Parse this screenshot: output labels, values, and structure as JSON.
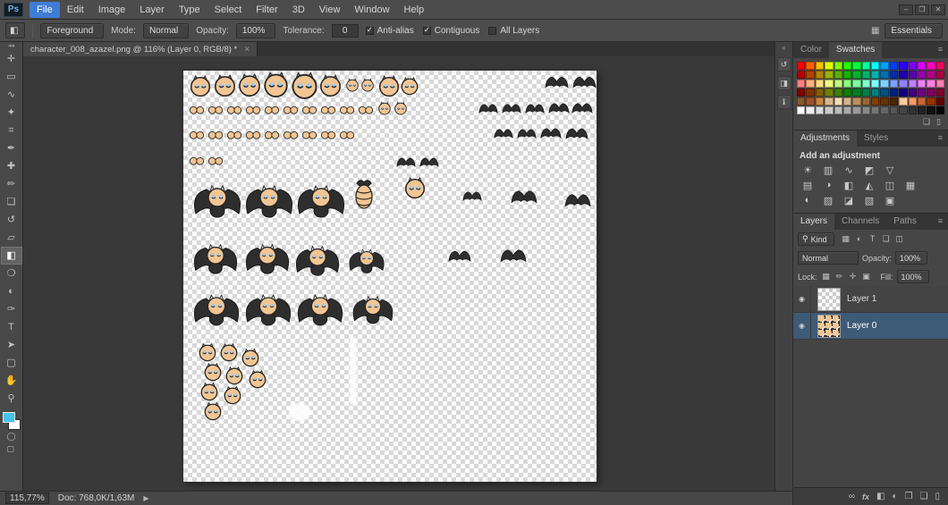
{
  "ui": {
    "caret": "▾",
    "panel_menu": "≡",
    "eye": "◉",
    "search": "⚲"
  },
  "app": {
    "logo": "Ps"
  },
  "window_controls": [
    {
      "name": "minimize",
      "glyph": "–"
    },
    {
      "name": "restore",
      "glyph": "❐"
    },
    {
      "name": "close",
      "glyph": "✕"
    }
  ],
  "menu": {
    "items": [
      {
        "label": "File",
        "active": true
      },
      {
        "label": "Edit"
      },
      {
        "label": "Image"
      },
      {
        "label": "Layer"
      },
      {
        "label": "Type"
      },
      {
        "label": "Select"
      },
      {
        "label": "Filter"
      },
      {
        "label": "3D"
      },
      {
        "label": "View"
      },
      {
        "label": "Window"
      },
      {
        "label": "Help"
      }
    ]
  },
  "options": {
    "tool_preset_glyph": "◧",
    "fill_source": {
      "value": "Foreground"
    },
    "mode_label": "Mode:",
    "mode_value": "Normal",
    "opacity_label": "Opacity:",
    "opacity_value": "100%",
    "tolerance_label": "Tolerance:",
    "tolerance_value": "0",
    "checkboxes": [
      {
        "label": "Anti-alias",
        "checked": true
      },
      {
        "label": "Contiguous",
        "checked": true
      },
      {
        "label": "All Layers",
        "checked": false
      }
    ],
    "workspace": {
      "label": "Essentials",
      "grid_glyph": "▦"
    }
  },
  "document_tab": {
    "title": "character_008_azazel.png @ 116% (Layer 0, RGB/8) *",
    "close_glyph": "×"
  },
  "toolbar": {
    "collapse_glyph": "◂◂",
    "tools": [
      {
        "name": "move",
        "glyph": "✛"
      },
      {
        "name": "rectangular-marquee",
        "glyph": "▭"
      },
      {
        "name": "lasso",
        "glyph": "∿"
      },
      {
        "name": "magic-wand",
        "glyph": "✦"
      },
      {
        "name": "crop",
        "glyph": "⌗"
      },
      {
        "name": "eyedropper",
        "glyph": "✒"
      },
      {
        "name": "spot-healing-brush",
        "glyph": "✚"
      },
      {
        "name": "brush",
        "glyph": "✏"
      },
      {
        "name": "clone-stamp",
        "glyph": "❏"
      },
      {
        "name": "history-brush",
        "glyph": "↺"
      },
      {
        "name": "eraser",
        "glyph": "▱"
      },
      {
        "name": "paint-bucket",
        "glyph": "◧",
        "selected": true
      },
      {
        "name": "blur",
        "glyph": "❍"
      },
      {
        "name": "dodge",
        "glyph": "◐"
      },
      {
        "name": "pen",
        "glyph": "✑"
      },
      {
        "name": "type",
        "glyph": "T"
      },
      {
        "name": "path-selection",
        "glyph": "➤"
      },
      {
        "name": "rectangle",
        "glyph": "▢"
      },
      {
        "name": "hand",
        "glyph": "✋"
      },
      {
        "name": "zoom",
        "glyph": "⚲"
      }
    ],
    "foreground_color": "#44c4e6",
    "background_color": "#ffffff",
    "extras": [
      {
        "name": "quick-mask",
        "glyph": "◯"
      },
      {
        "name": "screen-mode",
        "glyph": "▢"
      }
    ]
  },
  "dock": {
    "collapse_glyph": "«",
    "icons": [
      {
        "name": "history",
        "glyph": "↺"
      },
      {
        "name": "properties",
        "glyph": "◨"
      },
      {
        "name": "info",
        "glyph": "ℹ"
      }
    ]
  },
  "panels": {
    "colors": {
      "tabs": [
        {
          "label": "Color"
        },
        {
          "label": "Swatches",
          "active": true
        }
      ],
      "palette": [
        "#ff0000",
        "#ff6000",
        "#ffbf00",
        "#dfff00",
        "#80ff00",
        "#21ff00",
        "#00ff40",
        "#00ffa0",
        "#00ffff",
        "#00a0ff",
        "#0040ff",
        "#2a00ff",
        "#8000ff",
        "#df00ff",
        "#ff00bf",
        "#ff0060",
        "#b30000",
        "#b34300",
        "#b38600",
        "#9cb300",
        "#59b300",
        "#17b300",
        "#00b32d",
        "#00b370",
        "#00b3b3",
        "#0070b3",
        "#002db3",
        "#1d00b3",
        "#5900b3",
        "#9c00b3",
        "#b30086",
        "#b30043",
        "#ff8080",
        "#ffb080",
        "#ffdf80",
        "#efff80",
        "#bfff80",
        "#90ff80",
        "#80ffa0",
        "#80ffd0",
        "#80ffff",
        "#80d0ff",
        "#80a0ff",
        "#9580ff",
        "#c080ff",
        "#ef80ff",
        "#ff80df",
        "#ff80b0",
        "#800000",
        "#803000",
        "#806000",
        "#708000",
        "#408000",
        "#108000",
        "#008020",
        "#008050",
        "#008080",
        "#005080",
        "#002080",
        "#150080",
        "#400080",
        "#700080",
        "#800060",
        "#800030",
        "#8b5a2b",
        "#a0522d",
        "#cd853f",
        "#deb887",
        "#f5deb3",
        "#d2b48c",
        "#bc8f60",
        "#996633",
        "#804000",
        "#663300",
        "#4d2600",
        "#ffcc99",
        "#ff9966",
        "#cc6633",
        "#993300",
        "#660000",
        "#ffffff",
        "#eeeeee",
        "#dddddd",
        "#cccccc",
        "#bbbbbb",
        "#aaaaaa",
        "#999999",
        "#888888",
        "#777777",
        "#666666",
        "#555555",
        "#444444",
        "#333333",
        "#222222",
        "#111111",
        "#000000"
      ],
      "buttons": [
        {
          "name": "new-swatch",
          "glyph": "❏"
        },
        {
          "name": "delete-swatch",
          "glyph": "▯"
        }
      ]
    },
    "adjustments": {
      "tabs": [
        {
          "label": "Adjustments",
          "active": true
        },
        {
          "label": "Styles"
        }
      ],
      "heading": "Add an adjustment",
      "rows": [
        [
          {
            "name": "brightness-contrast",
            "glyph": "☀"
          },
          {
            "name": "levels",
            "glyph": "▥"
          },
          {
            "name": "curves",
            "glyph": "∿"
          },
          {
            "name": "exposure",
            "glyph": "◩"
          },
          {
            "name": "vibrance",
            "glyph": "▽"
          }
        ],
        [
          {
            "name": "hue-saturation",
            "glyph": "▤"
          },
          {
            "name": "color-balance",
            "glyph": "◑"
          },
          {
            "name": "black-white",
            "glyph": "◧"
          },
          {
            "name": "photo-filter",
            "glyph": "◭"
          },
          {
            "name": "channel-mixer",
            "glyph": "◫"
          },
          {
            "name": "color-lookup",
            "glyph": "▦"
          }
        ],
        [
          {
            "name": "invert",
            "glyph": "◐"
          },
          {
            "name": "posterize",
            "glyph": "▨"
          },
          {
            "name": "threshold",
            "glyph": "◪"
          },
          {
            "name": "gradient-map",
            "glyph": "▧"
          },
          {
            "name": "selective-color",
            "glyph": "▣"
          }
        ]
      ]
    },
    "layers": {
      "tabs": [
        {
          "label": "Layers",
          "active": true
        },
        {
          "label": "Channels"
        },
        {
          "label": "Paths"
        }
      ],
      "filter": {
        "kind_label": "Kind",
        "icons": [
          {
            "name": "filter-pixel-layers",
            "glyph": "▦"
          },
          {
            "name": "filter-adjustment-layers",
            "glyph": "◐"
          },
          {
            "name": "filter-type-layers",
            "glyph": "T"
          },
          {
            "name": "filter-shape-layers",
            "glyph": "❏"
          },
          {
            "name": "filter-smart-objects",
            "glyph": "◫"
          }
        ]
      },
      "blend": {
        "value": "Normal",
        "opacity_label": "Opacity:",
        "opacity_value": "100%"
      },
      "lock": {
        "label": "Lock:",
        "icons": [
          {
            "name": "lock-transparent-pixels",
            "glyph": "▦"
          },
          {
            "name": "lock-image-pixels",
            "glyph": "✏"
          },
          {
            "name": "lock-position",
            "glyph": "✛"
          },
          {
            "name": "lock-all",
            "glyph": "▣"
          }
        ],
        "fill_label": "Fill:",
        "fill_value": "100%"
      },
      "items": [
        {
          "name": "Layer 1",
          "selected": false,
          "thumb": "checker"
        },
        {
          "name": "Layer 0",
          "selected": true,
          "thumb": "sprite"
        }
      ],
      "footer": [
        {
          "name": "link-layers",
          "glyph": "∞"
        },
        {
          "name": "layer-effects",
          "glyph": "fx"
        },
        {
          "name": "add-layer-mask",
          "glyph": "◧"
        },
        {
          "name": "new-adjustment-layer",
          "glyph": "◐"
        },
        {
          "name": "new-group",
          "glyph": "❐"
        },
        {
          "name": "new-layer",
          "glyph": "❏"
        },
        {
          "name": "delete-layer",
          "glyph": "▯"
        }
      ]
    }
  },
  "canvas": {
    "sprite_colors": {
      "skin": "#f3c592",
      "wing": "#2e2e2e",
      "outline": "#262626",
      "horn": "#ececec",
      "eyelid": "#a9c9e2"
    },
    "sprites": [
      [
        "h",
        6,
        4,
        26
      ],
      [
        "h",
        33,
        3,
        27
      ],
      [
        "h",
        60,
        2,
        28
      ],
      [
        "h",
        88,
        0,
        31
      ],
      [
        "h",
        119,
        0,
        33
      ],
      [
        "h",
        151,
        3,
        27
      ],
      [
        "h",
        181,
        8,
        16
      ],
      [
        "h",
        198,
        8,
        16
      ],
      [
        "h",
        217,
        4,
        26
      ],
      [
        "h",
        242,
        6,
        22
      ],
      [
        "w",
        404,
        5,
        27
      ],
      [
        "w",
        435,
        5,
        27
      ],
      [
        "e",
        6,
        38,
        18
      ],
      [
        "e",
        27,
        38,
        18
      ],
      [
        "e",
        48,
        38,
        18
      ],
      [
        "e",
        69,
        38,
        18
      ],
      [
        "e",
        90,
        38,
        18
      ],
      [
        "e",
        111,
        38,
        18
      ],
      [
        "e",
        132,
        38,
        18
      ],
      [
        "e",
        153,
        38,
        18
      ],
      [
        "e",
        174,
        38,
        18
      ],
      [
        "e",
        195,
        38,
        18
      ],
      [
        "h",
        217,
        34,
        16
      ],
      [
        "h",
        235,
        34,
        16
      ],
      [
        "w",
        330,
        36,
        22
      ],
      [
        "w",
        356,
        36,
        22
      ],
      [
        "w",
        382,
        36,
        22
      ],
      [
        "w",
        408,
        35,
        24
      ],
      [
        "w",
        434,
        35,
        24
      ],
      [
        "e",
        6,
        66,
        18
      ],
      [
        "e",
        27,
        66,
        18
      ],
      [
        "e",
        48,
        66,
        18
      ],
      [
        "e",
        69,
        66,
        18
      ],
      [
        "e",
        90,
        66,
        18
      ],
      [
        "e",
        111,
        66,
        18
      ],
      [
        "e",
        132,
        66,
        18
      ],
      [
        "e",
        153,
        66,
        18
      ],
      [
        "e",
        174,
        66,
        18
      ],
      [
        "w",
        347,
        64,
        22
      ],
      [
        "w",
        373,
        64,
        22
      ],
      [
        "w",
        399,
        63,
        24
      ],
      [
        "w",
        427,
        63,
        26
      ],
      [
        "e",
        6,
        95,
        18
      ],
      [
        "e",
        27,
        95,
        18
      ],
      [
        "w",
        238,
        96,
        22
      ],
      [
        "w",
        264,
        96,
        22
      ],
      [
        "b",
        10,
        126,
        56
      ],
      [
        "b",
        68,
        126,
        56
      ],
      [
        "b",
        126,
        126,
        56
      ],
      [
        "p",
        190,
        120,
        24
      ],
      [
        "h",
        246,
        118,
        26
      ],
      [
        "w",
        312,
        134,
        22
      ],
      [
        "w",
        366,
        132,
        30
      ],
      [
        "w",
        426,
        136,
        30
      ],
      [
        "b",
        10,
        192,
        52
      ],
      [
        "b",
        68,
        192,
        52
      ],
      [
        "b",
        124,
        194,
        52
      ],
      [
        "b",
        184,
        198,
        42
      ],
      [
        "w",
        296,
        200,
        26
      ],
      [
        "w",
        354,
        198,
        30
      ],
      [
        "b",
        10,
        248,
        54
      ],
      [
        "b",
        68,
        248,
        54
      ],
      [
        "b",
        126,
        248,
        54
      ],
      [
        "b",
        188,
        250,
        48
      ],
      [
        "h",
        16,
        304,
        22
      ],
      [
        "h",
        40,
        304,
        22
      ],
      [
        "h",
        64,
        310,
        22
      ],
      [
        "h",
        22,
        326,
        22
      ],
      [
        "h",
        46,
        330,
        22
      ],
      [
        "h",
        72,
        334,
        22
      ],
      [
        "h",
        18,
        348,
        22
      ],
      [
        "h",
        44,
        352,
        22
      ],
      [
        "h",
        22,
        370,
        22
      ],
      [
        "s",
        186,
        298,
        8
      ],
      [
        "o",
        118,
        372,
        24
      ]
    ]
  },
  "status_bar": {
    "zoom": "115,77%",
    "doc": "Doc: 768,0K/1,63M",
    "arrow_glyph": "▶"
  }
}
